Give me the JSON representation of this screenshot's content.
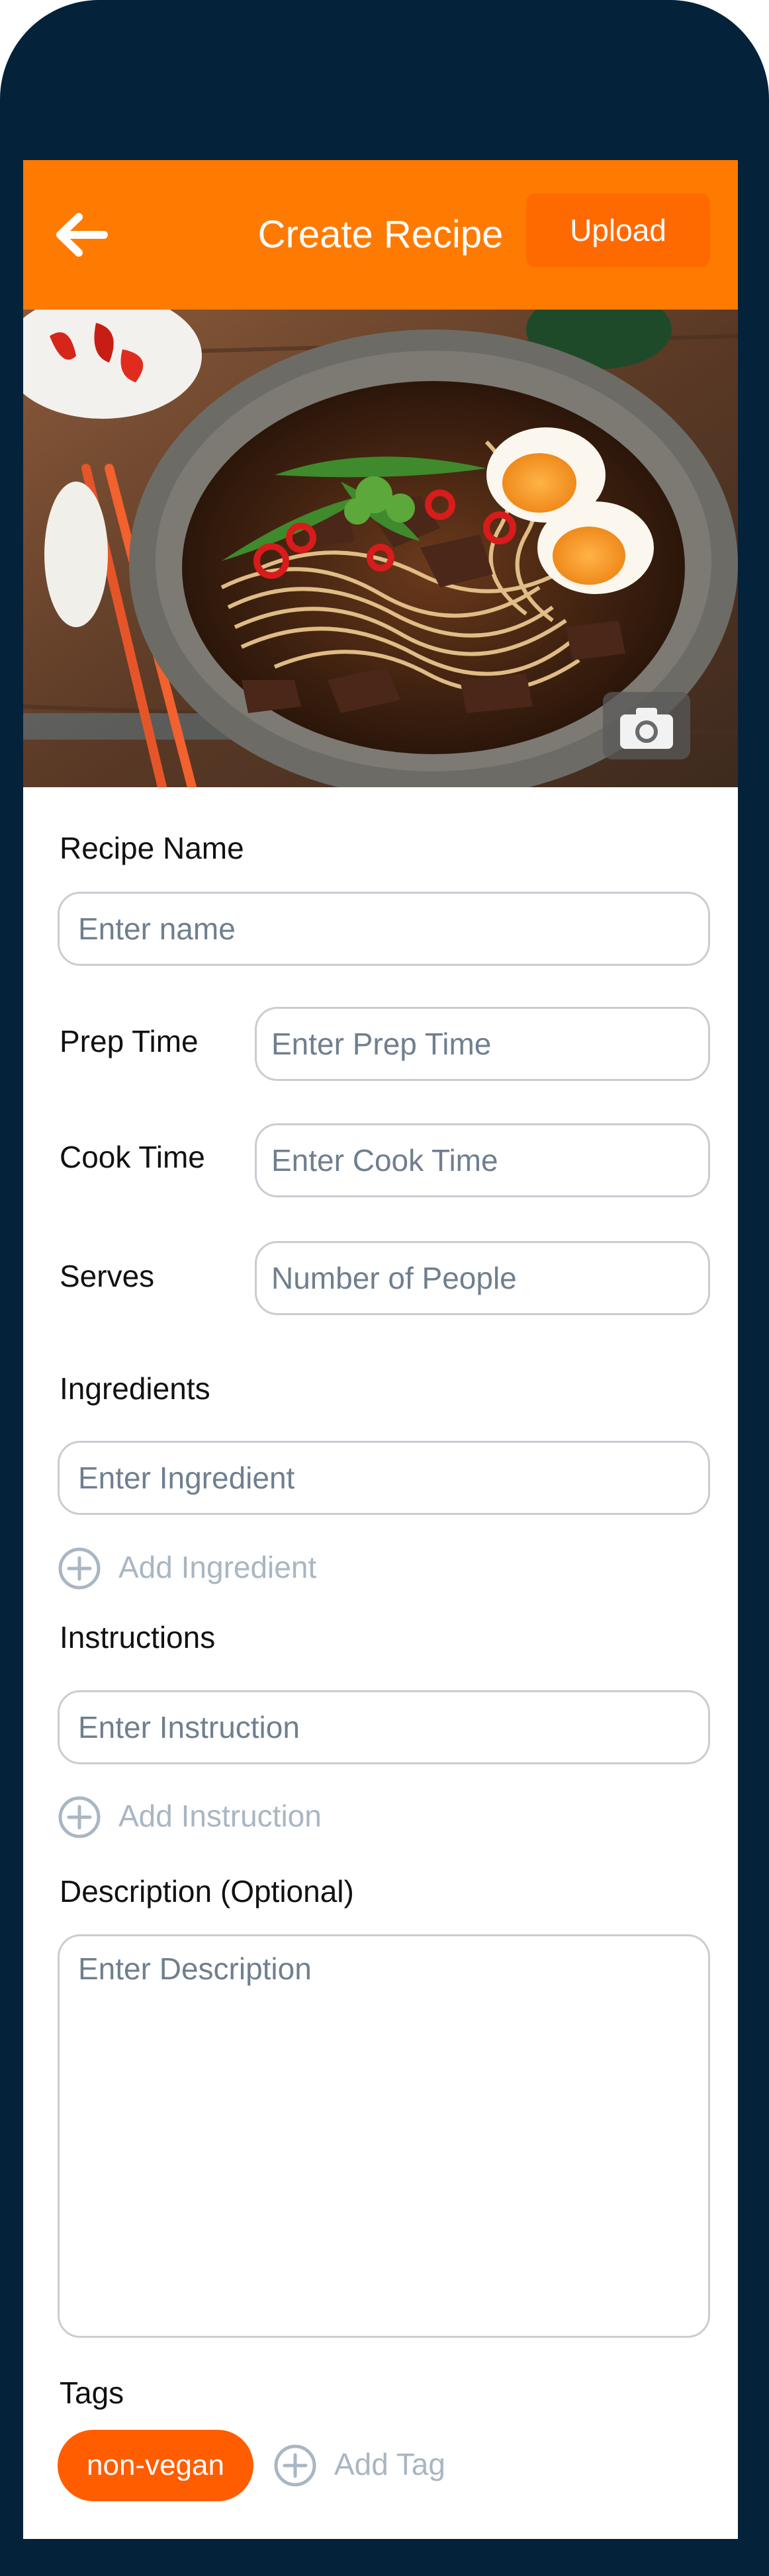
{
  "app_bar": {
    "title": "Create Recipe",
    "upload_label": "Upload",
    "back_icon": "arrow-left-icon"
  },
  "hero": {
    "camera_icon": "camera-icon"
  },
  "form": {
    "recipe_name": {
      "label": "Recipe Name",
      "placeholder": "Enter name",
      "value": ""
    },
    "prep_time": {
      "label": "Prep Time",
      "placeholder": "Enter Prep Time",
      "value": ""
    },
    "cook_time": {
      "label": "Cook Time",
      "placeholder": "Enter Cook Time",
      "value": ""
    },
    "serves": {
      "label": "Serves",
      "placeholder": "Number of People",
      "value": ""
    },
    "ingredients": {
      "label": "Ingredients",
      "placeholder": "Enter Ingredient",
      "add_label": "Add Ingredient"
    },
    "instructions": {
      "label": "Instructions",
      "placeholder": "Enter Instruction",
      "add_label": "Add Instruction"
    },
    "description": {
      "label": "Description (Optional)",
      "placeholder": "Enter Description"
    },
    "tags": {
      "label": "Tags",
      "items": [
        "non-vegan"
      ],
      "add_label": "Add Tag"
    }
  },
  "colors": {
    "accent": "#ff7a00",
    "tag": "#ff5d00",
    "frame": "#04223a",
    "placeholder": "#6f7f8f",
    "muted": "#a9b6c3"
  }
}
